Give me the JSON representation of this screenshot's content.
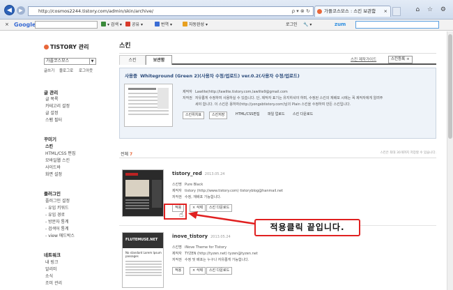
{
  "browser": {
    "address": "http://cosmos2244.tistory.com/admin/skin/archive/",
    "address_tools": "ρ ▾ ⊗ ↻",
    "tab_title": "가플코스모스 : 스킨 보관함",
    "tab_close": "×",
    "window_icons": "⌂ ☆ ⚙"
  },
  "toolbar": {
    "close": "×",
    "google": "Google",
    "items": [
      "검색",
      "공유",
      "번역",
      "자동완성",
      "로그인",
      "zum"
    ],
    "search_label": "▾ 검색 ▾",
    "share_label": "공유 ▾",
    "translate_label": "번역 ▾",
    "autocomplete_label": "자동완성 ▾",
    "login_label": "로그인",
    "tools_label": "🔧 ▾",
    "zum_label": "zum",
    "colors": {
      "search": "#3a8a3a",
      "share": "#d83a2a",
      "translate": "#3a6cd4",
      "auto": "#e8a020"
    }
  },
  "sidebar": {
    "logo": "TISTORY 관리",
    "blog_select": "가플코스모스",
    "btn_write": "글쓰기",
    "btn_blog": "블로그로",
    "btn_logout": "로그아웃",
    "sections": [
      {
        "title": "글 관리",
        "items": [
          "글 목록",
          "카테고리 설정",
          "글 설정",
          "스팸 필터"
        ]
      },
      {
        "title": "꾸미기",
        "items": [
          "스킨",
          "HTML/CSS 편집",
          "모바일웹 스킨",
          "사이드바",
          "화면 설정"
        ]
      },
      {
        "title": "플러그인",
        "items": [
          "플러그인 설정",
          "- 유입 키워드",
          "- 유입 경로",
          "- 방문자 통계",
          "- 검색어 통계",
          "- view 애드박스"
        ]
      },
      {
        "title": "네트워크",
        "items": [
          "내 링크",
          "알리미",
          "소식",
          "조미 관리"
        ]
      }
    ]
  },
  "main": {
    "title": "스킨",
    "tabs": [
      "스킨",
      "보관함"
    ],
    "link_guide": "스킨 제작가이드",
    "btn_register": "스킨등록 +",
    "current": {
      "label": "사용중",
      "name": "Whiteground (Green 2)(사용자 수정/업로드) ver.0.2(사용자 수정/업로드)",
      "maker_key": "제작자",
      "maker": "Lawlite(http://lawlite.tistory.com,lawlite9@gmail.com",
      "desc_key": "저작권",
      "desc_1": "자유롭게 수정하여 사용하실 수 있습니다. 단, 제작자 표기는 유지하셔야 하며, 수정된 스킨의 재배포 시에는 꼭 제작자에게 알려주",
      "desc_2": "세야 합니다. 이 스킨은 용하자(http://yongsbtistory.com)님의 Plain 스킨을 수정하여 만든 스킨입니다.",
      "buttons": [
        "스킨위치표",
        "스킨저장",
        "HTML/CSS편집",
        "파일 업로드",
        "스킨 다운로드"
      ]
    },
    "total_label": "전체",
    "total_count": "7",
    "total_note": "스킨은 최대 30개까지 저장할 수 있습니다.",
    "items": [
      {
        "name": "tistory_red",
        "date": "2013.05.24",
        "skin_key": "스킨명",
        "skin": "Pure Black",
        "maker_key": "제작자",
        "maker": "tistory (http://www.tistory.com) tistoryblog@hanmail.net",
        "copy_key": "저작권",
        "copy": "수정, 재배포 가능합니다.",
        "btn_apply": "적용",
        "btn_delete": "× 삭제",
        "btn_download": "스킨 다운로드"
      },
      {
        "name": "inove_tistory",
        "date": "2013.05.24",
        "skin_key": "스킨명",
        "skin": "iNove Theme for Tistory",
        "maker_key": "제작자",
        "maker": "TYZEN (http://tyzen.net) tyzen@tyzen.net",
        "copy_key": "저작권",
        "copy": "수정 및 배포는 누구나 자유롭게 가능합니다.",
        "btn_apply": "적용",
        "btn_delete": "× 삭제",
        "btn_download": "스킨 다운로드",
        "thumb_title": "FLUTEMUSE.NET",
        "thumb_text": "No standard Lorem Ipsum passages"
      }
    ]
  },
  "annotation": {
    "callout": "적용클릭  끝입니다."
  }
}
